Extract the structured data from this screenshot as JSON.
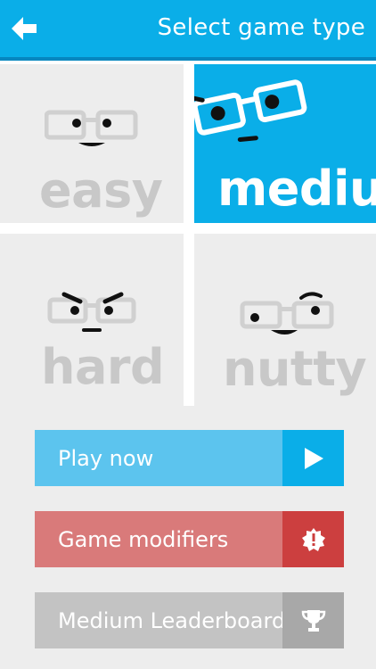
{
  "header": {
    "title": "Select game type",
    "back_icon": "arrow-left-icon"
  },
  "difficulties": [
    {
      "label": "easy",
      "selected": false
    },
    {
      "label": "medium",
      "selected": true
    },
    {
      "label": "hard",
      "selected": false
    },
    {
      "label": "nutty",
      "selected": false
    }
  ],
  "actions": {
    "play_label": "Play now",
    "play_icon": "play-icon",
    "modifiers_label": "Game modifiers",
    "modifiers_icon": "alert-badge-icon",
    "leaderboard_label": "Medium Leaderboard",
    "leaderboard_icon": "trophy-icon"
  },
  "colors": {
    "header": "#0aaee8",
    "selected_tile": "#0aaee8",
    "play_button": "#5cc4ee",
    "play_icon_bg": "#0aaee8",
    "modifiers_button": "#d97a7a",
    "modifiers_icon_bg": "#cc3f3f",
    "leaderboard_button": "#c3c3c3",
    "leaderboard_icon_bg": "#a8a8a8"
  }
}
